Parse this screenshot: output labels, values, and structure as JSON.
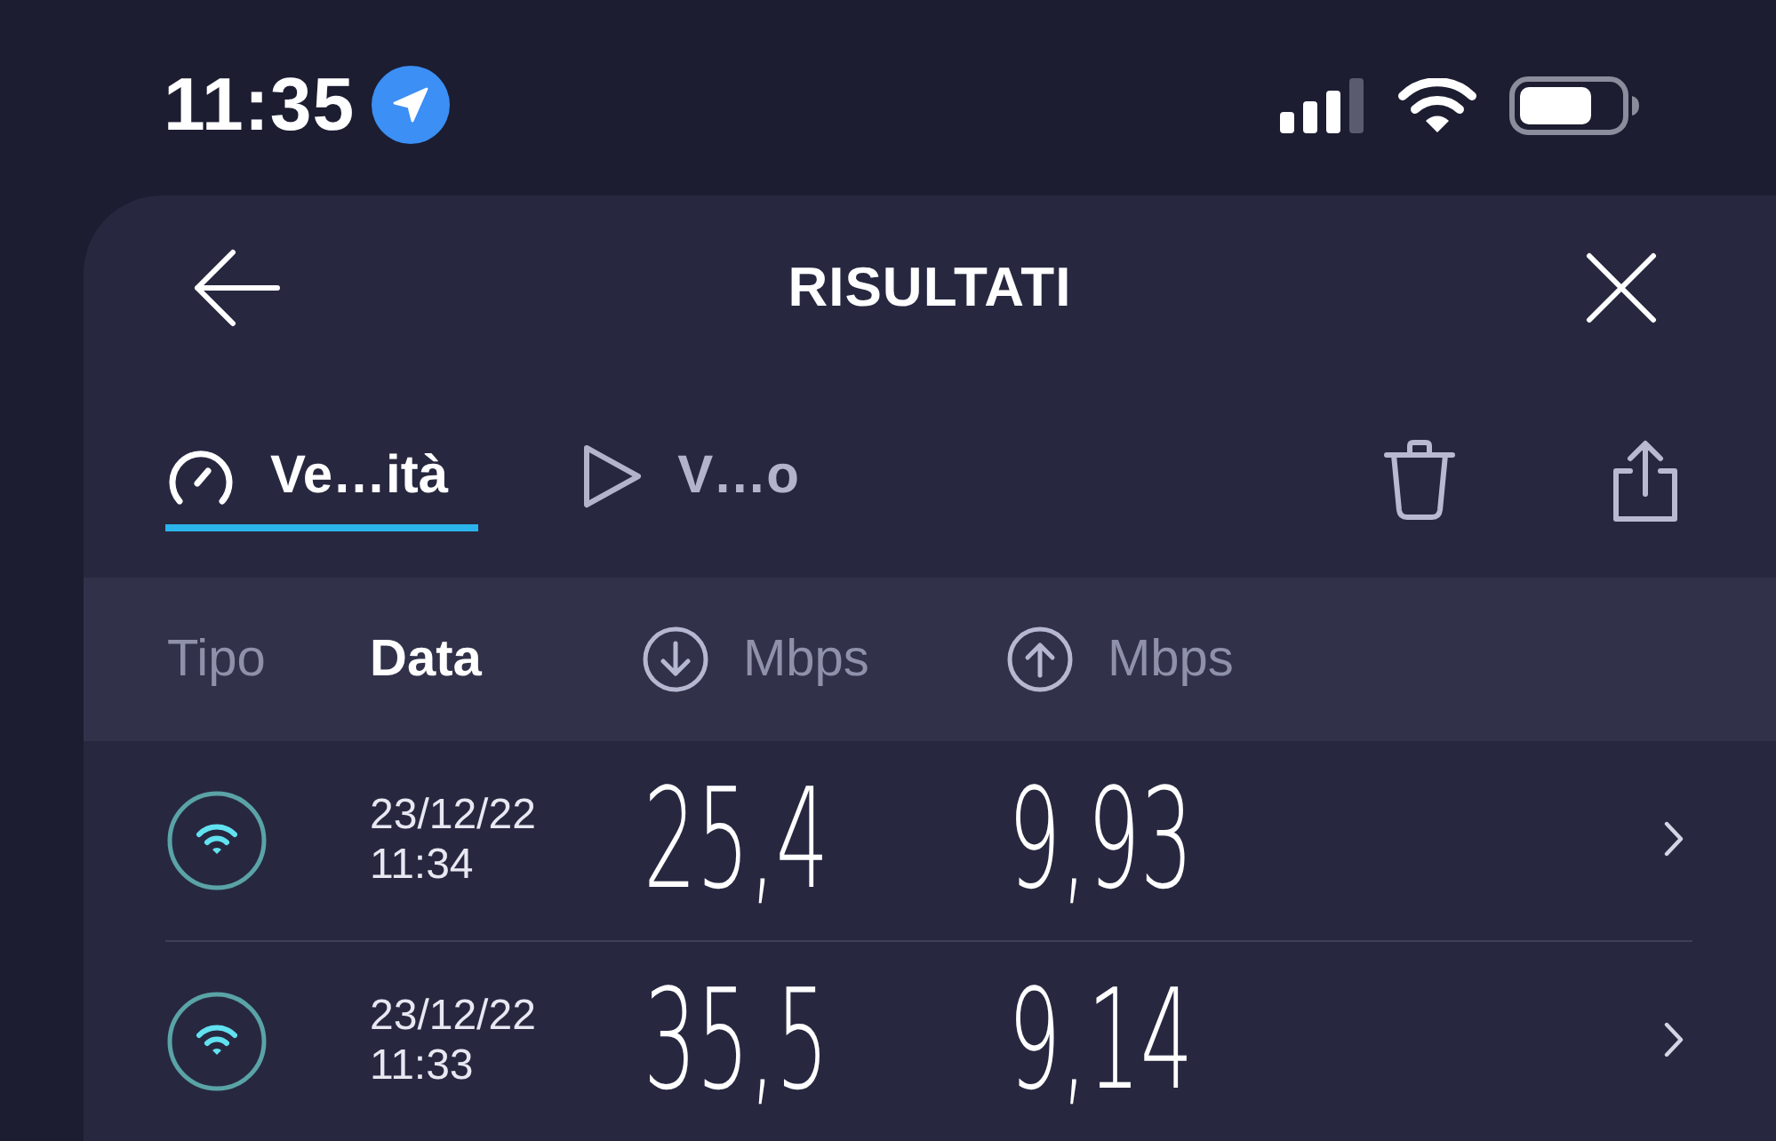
{
  "status_bar": {
    "time": "11:35"
  },
  "header": {
    "title": "RISULTATI"
  },
  "tabs": [
    {
      "kind": "speed",
      "label": "Ve…ità",
      "selected": true
    },
    {
      "kind": "video",
      "label": "V…o",
      "selected": false
    }
  ],
  "table": {
    "columns": [
      {
        "kind": "text",
        "label": "Tipo",
        "selected": false
      },
      {
        "kind": "text",
        "label": "Data",
        "selected": true
      },
      {
        "kind": "download",
        "label": "Mbps",
        "selected": false
      },
      {
        "kind": "upload",
        "label": "Mbps",
        "selected": false
      }
    ],
    "rows": [
      {
        "kind": "wifi",
        "date": "23/12/22",
        "time": "11:34",
        "download": "25,4",
        "upload": "9,93"
      },
      {
        "kind": "wifi",
        "date": "23/12/22",
        "time": "11:33",
        "download": "35,5",
        "upload": "9,14"
      }
    ]
  }
}
